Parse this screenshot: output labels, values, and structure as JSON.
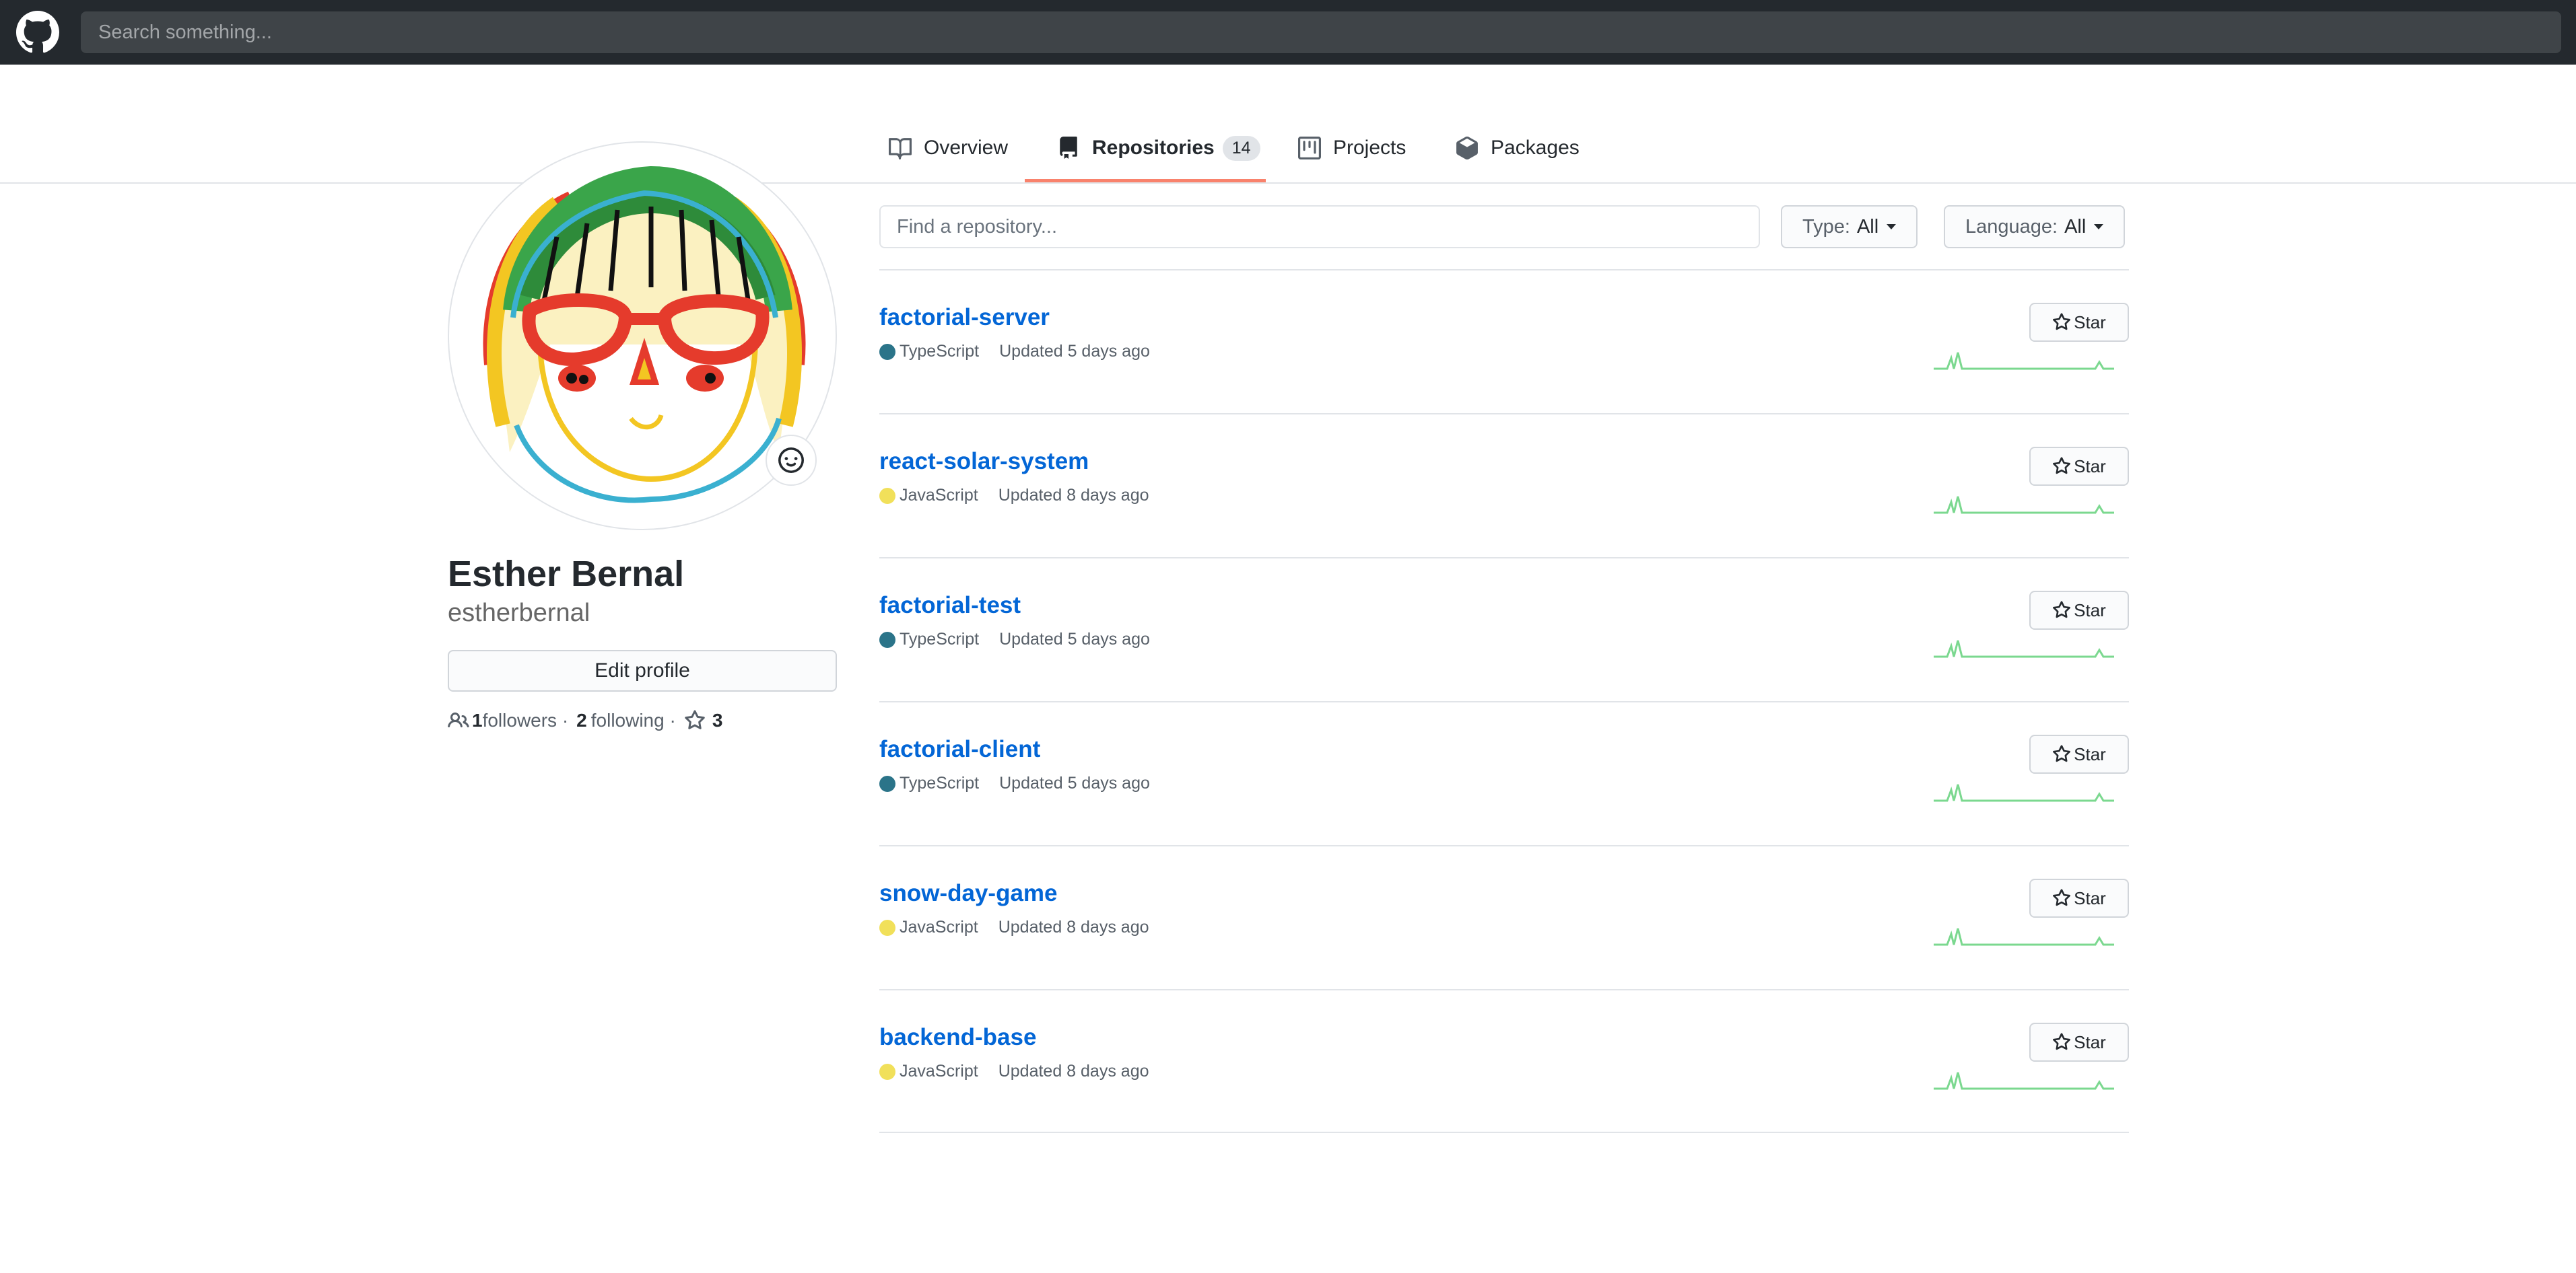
{
  "header": {
    "search_placeholder": "Search something..."
  },
  "tabs": [
    {
      "label": "Overview",
      "icon": "book-icon"
    },
    {
      "label": "Repositories",
      "count": "14",
      "icon": "repo-icon"
    },
    {
      "label": "Projects",
      "icon": "project-icon"
    },
    {
      "label": "Packages",
      "icon": "package-icon"
    }
  ],
  "active_tab": "Repositories",
  "accent_color": "#f9826c",
  "profile": {
    "name": "Esther Bernal",
    "login": "estherbernal",
    "edit_label": "Edit profile",
    "followers_count": "1",
    "followers_label": "followers ·",
    "following_count": "2",
    "following_label": "following ·",
    "stars_count": "3"
  },
  "filters": {
    "find_placeholder": "Find a repository...",
    "type_label": "Type:",
    "type_value": "All",
    "language_label": "Language:",
    "language_value": "All"
  },
  "star_label": "Star",
  "repos": [
    {
      "name": "factorial-server",
      "language": "TypeScript",
      "lang_color": "#2b7489",
      "updated": "Updated 5 days ago"
    },
    {
      "name": "react-solar-system",
      "language": "JavaScript",
      "lang_color": "#f1e05a",
      "updated": "Updated 8 days ago"
    },
    {
      "name": "factorial-test",
      "language": "TypeScript",
      "lang_color": "#2b7489",
      "updated": "Updated 5 days ago"
    },
    {
      "name": "factorial-client",
      "language": "TypeScript",
      "lang_color": "#2b7489",
      "updated": "Updated 5 days ago"
    },
    {
      "name": "snow-day-game",
      "language": "JavaScript",
      "lang_color": "#f1e05a",
      "updated": "Updated 8 days ago"
    },
    {
      "name": "backend-base",
      "language": "JavaScript",
      "lang_color": "#f1e05a",
      "updated": "Updated 8 days ago"
    }
  ]
}
